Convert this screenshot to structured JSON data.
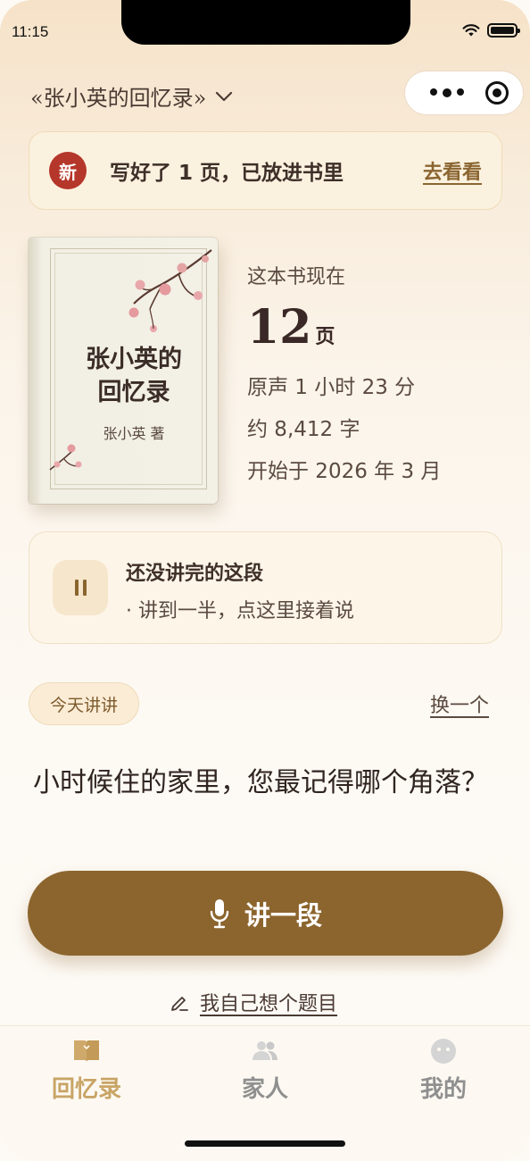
{
  "status_bar": {
    "time": "11:15"
  },
  "header": {
    "book_selector": "«张小英的回忆录»"
  },
  "notice": {
    "badge": "新",
    "text": "写好了 1 页，已放进书里",
    "link": "去看看"
  },
  "book": {
    "title_line1": "张小英的",
    "title_line2": "回忆录",
    "author": "张小英 著"
  },
  "stats": {
    "label": "这本书现在",
    "pages": "12",
    "pages_unit": "页",
    "audio": "原声 1 小时 23 分",
    "words": "约 8,412 字",
    "started": "开始于 2026 年 3 月"
  },
  "paused": {
    "title": "还没讲完的这段",
    "subtitle": "· 讲到一半，点这里接着说"
  },
  "prompt": {
    "tag": "今天讲讲",
    "switch": "换一个",
    "question": "小时候住的家里，您最记得哪个角落？",
    "talk_button": "讲一段",
    "own_topic": "我自己想个题目"
  },
  "tabs": [
    {
      "label": "回忆录",
      "icon": "book-icon",
      "active": true
    },
    {
      "label": "家人",
      "icon": "people-icon",
      "active": false
    },
    {
      "label": "我的",
      "icon": "face-icon",
      "active": false
    }
  ],
  "colors": {
    "accent": "#8c652e",
    "badge_red": "#b5362a",
    "tab_active": "#c8a466"
  }
}
